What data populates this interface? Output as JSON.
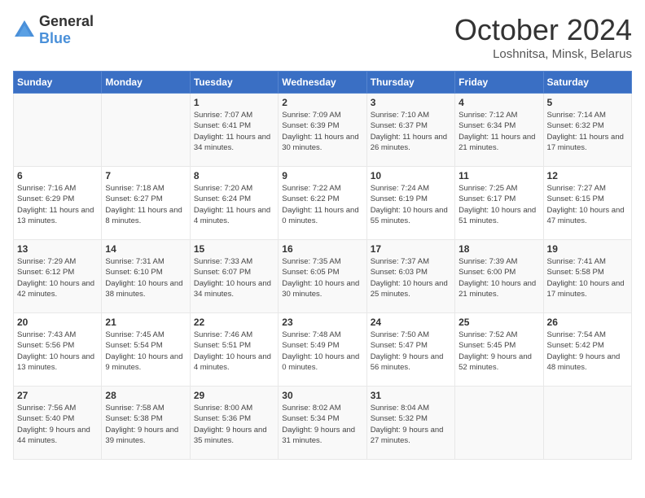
{
  "logo": {
    "general": "General",
    "blue": "Blue"
  },
  "title": "October 2024",
  "location": "Loshnitsa, Minsk, Belarus",
  "days_of_week": [
    "Sunday",
    "Monday",
    "Tuesday",
    "Wednesday",
    "Thursday",
    "Friday",
    "Saturday"
  ],
  "weeks": [
    [
      {
        "day": "",
        "text": ""
      },
      {
        "day": "",
        "text": ""
      },
      {
        "day": "1",
        "text": "Sunrise: 7:07 AM\nSunset: 6:41 PM\nDaylight: 11 hours and 34 minutes."
      },
      {
        "day": "2",
        "text": "Sunrise: 7:09 AM\nSunset: 6:39 PM\nDaylight: 11 hours and 30 minutes."
      },
      {
        "day": "3",
        "text": "Sunrise: 7:10 AM\nSunset: 6:37 PM\nDaylight: 11 hours and 26 minutes."
      },
      {
        "day": "4",
        "text": "Sunrise: 7:12 AM\nSunset: 6:34 PM\nDaylight: 11 hours and 21 minutes."
      },
      {
        "day": "5",
        "text": "Sunrise: 7:14 AM\nSunset: 6:32 PM\nDaylight: 11 hours and 17 minutes."
      }
    ],
    [
      {
        "day": "6",
        "text": "Sunrise: 7:16 AM\nSunset: 6:29 PM\nDaylight: 11 hours and 13 minutes."
      },
      {
        "day": "7",
        "text": "Sunrise: 7:18 AM\nSunset: 6:27 PM\nDaylight: 11 hours and 8 minutes."
      },
      {
        "day": "8",
        "text": "Sunrise: 7:20 AM\nSunset: 6:24 PM\nDaylight: 11 hours and 4 minutes."
      },
      {
        "day": "9",
        "text": "Sunrise: 7:22 AM\nSunset: 6:22 PM\nDaylight: 11 hours and 0 minutes."
      },
      {
        "day": "10",
        "text": "Sunrise: 7:24 AM\nSunset: 6:19 PM\nDaylight: 10 hours and 55 minutes."
      },
      {
        "day": "11",
        "text": "Sunrise: 7:25 AM\nSunset: 6:17 PM\nDaylight: 10 hours and 51 minutes."
      },
      {
        "day": "12",
        "text": "Sunrise: 7:27 AM\nSunset: 6:15 PM\nDaylight: 10 hours and 47 minutes."
      }
    ],
    [
      {
        "day": "13",
        "text": "Sunrise: 7:29 AM\nSunset: 6:12 PM\nDaylight: 10 hours and 42 minutes."
      },
      {
        "day": "14",
        "text": "Sunrise: 7:31 AM\nSunset: 6:10 PM\nDaylight: 10 hours and 38 minutes."
      },
      {
        "day": "15",
        "text": "Sunrise: 7:33 AM\nSunset: 6:07 PM\nDaylight: 10 hours and 34 minutes."
      },
      {
        "day": "16",
        "text": "Sunrise: 7:35 AM\nSunset: 6:05 PM\nDaylight: 10 hours and 30 minutes."
      },
      {
        "day": "17",
        "text": "Sunrise: 7:37 AM\nSunset: 6:03 PM\nDaylight: 10 hours and 25 minutes."
      },
      {
        "day": "18",
        "text": "Sunrise: 7:39 AM\nSunset: 6:00 PM\nDaylight: 10 hours and 21 minutes."
      },
      {
        "day": "19",
        "text": "Sunrise: 7:41 AM\nSunset: 5:58 PM\nDaylight: 10 hours and 17 minutes."
      }
    ],
    [
      {
        "day": "20",
        "text": "Sunrise: 7:43 AM\nSunset: 5:56 PM\nDaylight: 10 hours and 13 minutes."
      },
      {
        "day": "21",
        "text": "Sunrise: 7:45 AM\nSunset: 5:54 PM\nDaylight: 10 hours and 9 minutes."
      },
      {
        "day": "22",
        "text": "Sunrise: 7:46 AM\nSunset: 5:51 PM\nDaylight: 10 hours and 4 minutes."
      },
      {
        "day": "23",
        "text": "Sunrise: 7:48 AM\nSunset: 5:49 PM\nDaylight: 10 hours and 0 minutes."
      },
      {
        "day": "24",
        "text": "Sunrise: 7:50 AM\nSunset: 5:47 PM\nDaylight: 9 hours and 56 minutes."
      },
      {
        "day": "25",
        "text": "Sunrise: 7:52 AM\nSunset: 5:45 PM\nDaylight: 9 hours and 52 minutes."
      },
      {
        "day": "26",
        "text": "Sunrise: 7:54 AM\nSunset: 5:42 PM\nDaylight: 9 hours and 48 minutes."
      }
    ],
    [
      {
        "day": "27",
        "text": "Sunrise: 7:56 AM\nSunset: 5:40 PM\nDaylight: 9 hours and 44 minutes."
      },
      {
        "day": "28",
        "text": "Sunrise: 7:58 AM\nSunset: 5:38 PM\nDaylight: 9 hours and 39 minutes."
      },
      {
        "day": "29",
        "text": "Sunrise: 8:00 AM\nSunset: 5:36 PM\nDaylight: 9 hours and 35 minutes."
      },
      {
        "day": "30",
        "text": "Sunrise: 8:02 AM\nSunset: 5:34 PM\nDaylight: 9 hours and 31 minutes."
      },
      {
        "day": "31",
        "text": "Sunrise: 8:04 AM\nSunset: 5:32 PM\nDaylight: 9 hours and 27 minutes."
      },
      {
        "day": "",
        "text": ""
      },
      {
        "day": "",
        "text": ""
      }
    ]
  ]
}
